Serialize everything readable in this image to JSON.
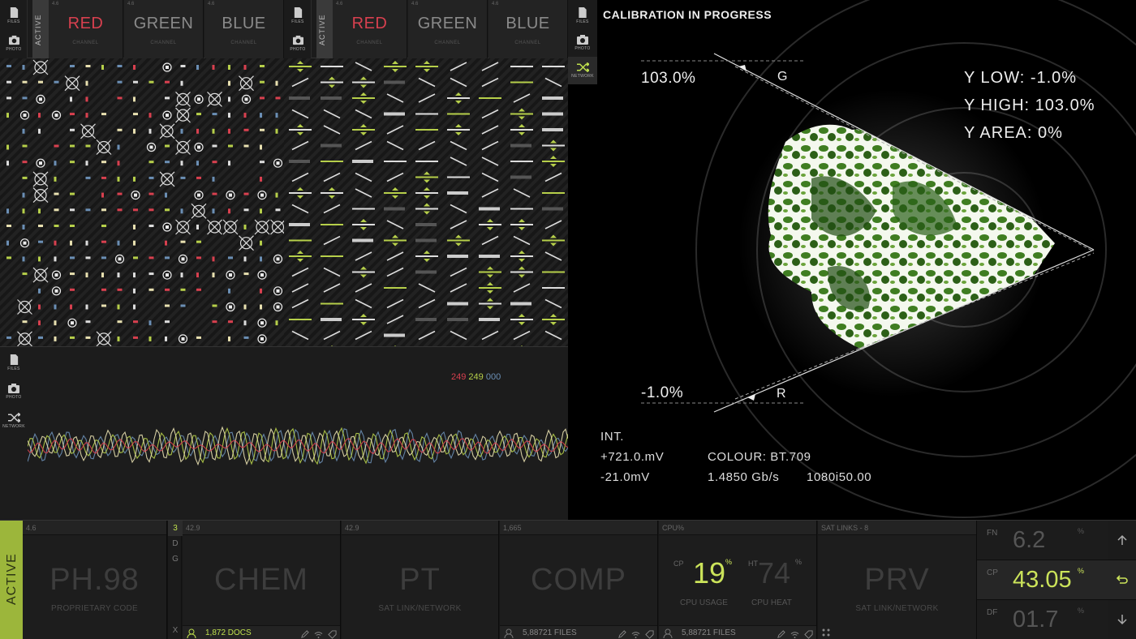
{
  "icons": {
    "files": "FILES",
    "photo": "PHOTO",
    "network": "NETWORK"
  },
  "left_strip": {
    "active": "ACTIVE",
    "num": "4.6",
    "channels": [
      {
        "name": "RED",
        "sub": "CHANNEL",
        "num": "4.6"
      },
      {
        "name": "GREEN",
        "sub": "CHANNEL",
        "num": "4.6"
      },
      {
        "name": "BLUE",
        "sub": "CHANNEL",
        "num": "4.6"
      }
    ]
  },
  "right_strip": {
    "active": "ACTIVE",
    "channels": [
      {
        "name": "RED",
        "sub": "CHANNEL",
        "num": "4.6"
      },
      {
        "name": "GREEN",
        "sub": "CHANNEL",
        "num": "4.6"
      },
      {
        "name": "BLUE",
        "sub": "CHANNEL",
        "num": "4.6"
      }
    ]
  },
  "waveform": {
    "r": "249",
    "g": "249",
    "b": "000"
  },
  "scope": {
    "title": "CALIBRATION IN PROGRESS",
    "top_pct": "103.0%",
    "bottom_pct": "-1.0%",
    "g_label": "G",
    "r_label": "R",
    "y_low": "Y LOW: -1.0%",
    "y_high": "Y HIGH: 103.0%",
    "y_area": "Y AREA: 0%",
    "int_label": "INT.",
    "mv_high": "+721.0.mV",
    "mv_low": "-21.0mV",
    "colour": "COLOUR: BT.709",
    "rate": "1.4850 Gb/s",
    "format": "1080i50.00"
  },
  "bottom": {
    "active": "ACTIVE",
    "tiles": [
      {
        "num": "4.6",
        "name": "PH.98",
        "sub": "PROPRIETARY CODE"
      },
      {
        "num": "42.9",
        "name": "CHEM",
        "sub": "",
        "footer": "1,872 DOCS"
      },
      {
        "num": "42.9",
        "name": "PT",
        "sub": "SAT LINK/NETWORK"
      },
      {
        "num": "1,665",
        "name": "COMP",
        "sub": "",
        "footer": "5,88721 FILES"
      },
      {
        "num": "CPU%",
        "footer": "5,88721 FILES"
      },
      {
        "num": "SAT LINKS - 8",
        "name": "PRV",
        "sub": "SAT LINK/NETWORK"
      }
    ],
    "side": [
      "3",
      "D",
      "G",
      "X"
    ],
    "cpu": {
      "cp_label": "CP",
      "cp_value": "19",
      "ht_label": "HT",
      "ht_value": "74",
      "pct": "%",
      "usage": "CPU USAGE",
      "heat": "CPU HEAT"
    },
    "stats": [
      {
        "label": "FN",
        "value": "6.2",
        "unit": "%"
      },
      {
        "label": "CP",
        "value": "43.05",
        "unit": "%"
      },
      {
        "label": "DF",
        "value": "01.7",
        "unit": "%"
      }
    ]
  },
  "colors": {
    "accent": "#9cb63b",
    "red": "#d8404f",
    "green_line": "#b6cf4a",
    "blue": "#6b8fb5"
  }
}
